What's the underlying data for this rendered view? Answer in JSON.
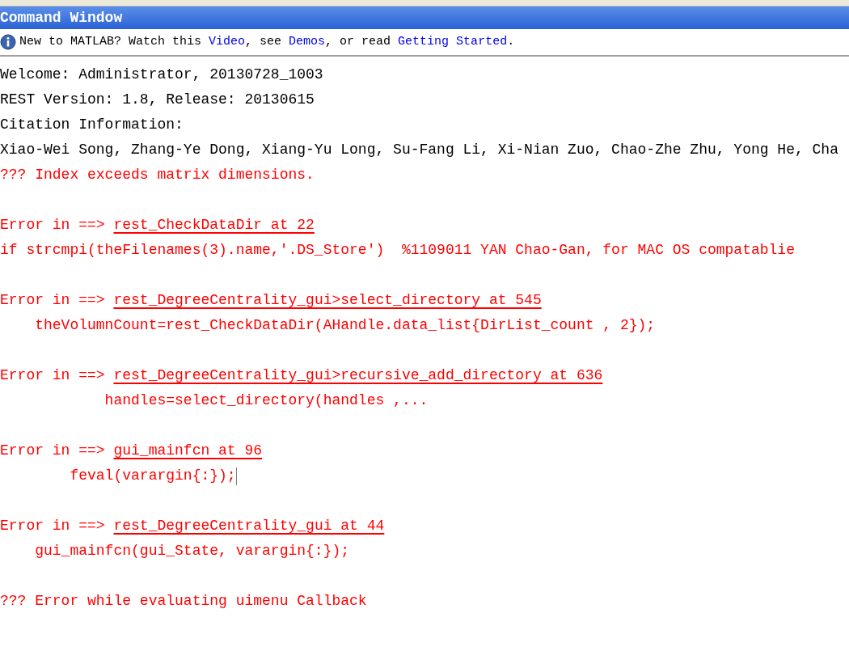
{
  "window": {
    "title": "Command Window"
  },
  "info_bar": {
    "parts": [
      {
        "kind": "text",
        "text": "New to MATLAB? Watch this "
      },
      {
        "kind": "link",
        "text": "Video"
      },
      {
        "kind": "text",
        "text": ", see "
      },
      {
        "kind": "link",
        "text": "Demos"
      },
      {
        "kind": "text",
        "text": ", or read "
      },
      {
        "kind": "link",
        "text": "Getting Started"
      },
      {
        "kind": "text",
        "text": "."
      }
    ]
  },
  "lines": [
    {
      "kind": "output",
      "text": "Welcome: Administrator, 20130728_1003"
    },
    {
      "kind": "output",
      "text": "REST Version: 1.8, Release: 20130615"
    },
    {
      "kind": "output",
      "text": "Citation Information:"
    },
    {
      "kind": "output",
      "text": "Xiao-Wei Song, Zhang-Ye Dong, Xiang-Yu Long, Su-Fang Li, Xi-Nian Zuo, Chao-Zhe Zhu, Yong He, Cha"
    },
    {
      "kind": "error",
      "text": "??? Index exceeds matrix dimensions."
    },
    {
      "kind": "blank"
    },
    {
      "kind": "error_in",
      "prefix": "Error in ==> ",
      "link": "rest_CheckDataDir at 22"
    },
    {
      "kind": "error",
      "text": "if strcmpi(theFilenames(3).name,'.DS_Store')  %1109011 YAN Chao-Gan, for MAC OS compatablie"
    },
    {
      "kind": "blank"
    },
    {
      "kind": "error_in",
      "prefix": "Error in ==> ",
      "link": "rest_DegreeCentrality_gui>select_directory at 545"
    },
    {
      "kind": "error",
      "text": "    theVolumnCount=rest_CheckDataDir(AHandle.data_list{DirList_count , 2});"
    },
    {
      "kind": "blank"
    },
    {
      "kind": "error_in",
      "prefix": "Error in ==> ",
      "link": "rest_DegreeCentrality_gui>recursive_add_directory at 636"
    },
    {
      "kind": "error",
      "text": "            handles=select_directory(handles ,..."
    },
    {
      "kind": "blank"
    },
    {
      "kind": "error_in",
      "prefix": "Error in ==> ",
      "link": "gui_mainfcn at 96"
    },
    {
      "kind": "error",
      "text": "        feval(varargin{:});",
      "cursor": true
    },
    {
      "kind": "blank"
    },
    {
      "kind": "error_in",
      "prefix": "Error in ==> ",
      "link": "rest_DegreeCentrality_gui at 44"
    },
    {
      "kind": "error",
      "text": "    gui_mainfcn(gui_State, varargin{:});"
    },
    {
      "kind": "blank"
    },
    {
      "kind": "error",
      "text": "??? Error while evaluating uimenu Callback"
    }
  ]
}
